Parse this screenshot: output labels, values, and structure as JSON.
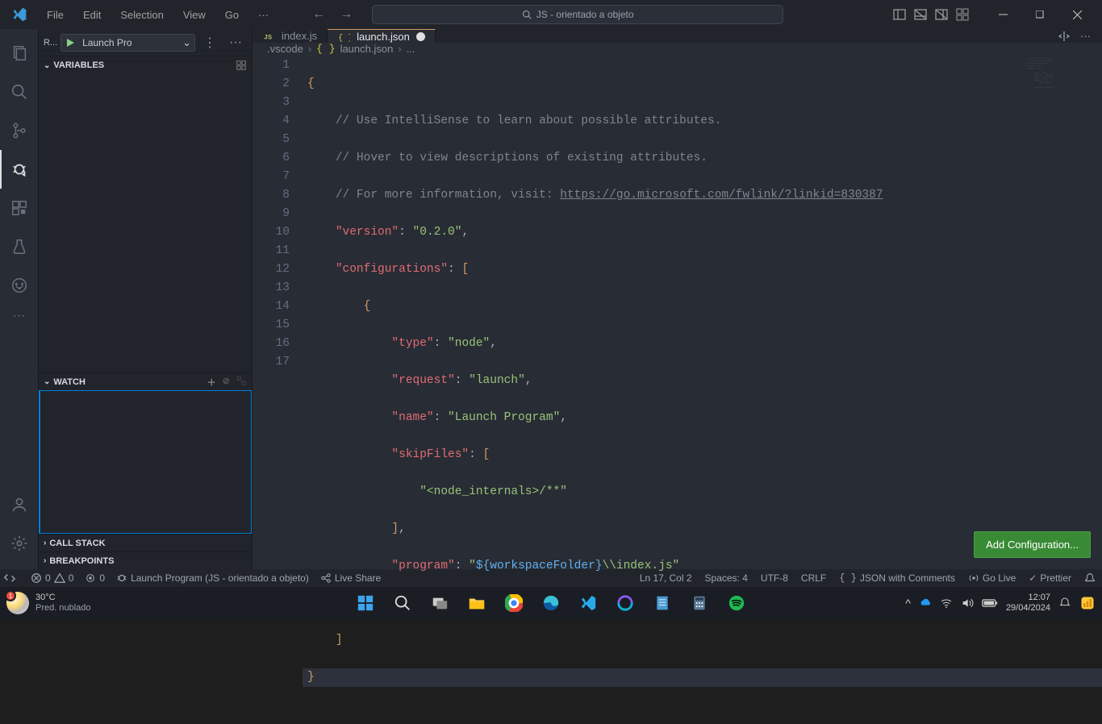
{
  "titlebar": {
    "menus": [
      "File",
      "Edit",
      "Selection",
      "View",
      "Go"
    ],
    "search_text": "JS - orientado a objeto"
  },
  "activity": {
    "items": [
      "files-icon",
      "search-icon",
      "source-control-icon",
      "debug-icon",
      "extensions-icon",
      "testing-icon",
      "git-graph-icon",
      "more-icon"
    ],
    "bottom": [
      "accounts-icon",
      "settings-icon"
    ],
    "active": "debug-icon"
  },
  "debug_panel": {
    "run_label_short": "R...",
    "config_name": "Launch Pro",
    "sections": {
      "variables": "VARIABLES",
      "watch": "WATCH",
      "call_stack": "CALL STACK",
      "breakpoints": "BREAKPOINTS"
    }
  },
  "tabs": [
    {
      "label": "index.js",
      "icon": "js-icon",
      "active": false,
      "dirty": false
    },
    {
      "label": "launch.json",
      "icon": "json-icon",
      "active": true,
      "dirty": true
    }
  ],
  "breadcrumbs": {
    "folder": ".vscode",
    "file": "launch.json",
    "more": "..."
  },
  "code": {
    "line_count": 17,
    "comment1": "// Use IntelliSense to learn about possible attributes.",
    "comment2": "// Hover to view descriptions of existing attributes.",
    "comment3_prefix": "// For more information, visit: ",
    "comment3_url": "https://go.microsoft.com/fwlink/?linkid=830387",
    "version_key": "\"version\"",
    "version_val": "\"0.2.0\"",
    "configs_key": "\"configurations\"",
    "type_key": "\"type\"",
    "type_val": "\"node\"",
    "request_key": "\"request\"",
    "request_val": "\"launch\"",
    "name_key": "\"name\"",
    "name_val": "\"Launch Program\"",
    "skip_key": "\"skipFiles\"",
    "skip_val": "\"<node_internals>/**\"",
    "program_key": "\"program\"",
    "program_val_open": "\"",
    "program_val_var": "${workspaceFolder}",
    "program_val_rest": "\\\\index.js\""
  },
  "add_config_button": "Add Configuration...",
  "status_bar": {
    "errors": "0",
    "warnings": "0",
    "ports": "0",
    "debug_target": "Launch Program (JS - orientado a objeto)",
    "live_share": "Live Share",
    "cursor": "Ln 17, Col 2",
    "spaces": "Spaces: 4",
    "encoding": "UTF-8",
    "eol": "CRLF",
    "language": "JSON with Comments",
    "go_live": "Go Live",
    "prettier": "Prettier"
  },
  "taskbar": {
    "weather_temp": "30°C",
    "weather_desc": "Pred. nublado",
    "clock_time": "12:07",
    "clock_date": "29/04/2024"
  }
}
